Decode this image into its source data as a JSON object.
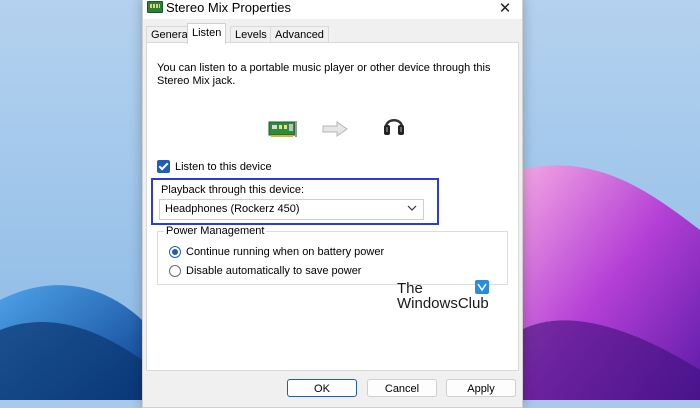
{
  "window": {
    "title": "Stereo Mix Properties",
    "app_icon": "sound-card-icon",
    "close_glyph": "✕"
  },
  "tabs": [
    {
      "label": "General",
      "active": false
    },
    {
      "label": "Listen",
      "active": true
    },
    {
      "label": "Levels",
      "active": false
    },
    {
      "label": "Advanced",
      "active": false
    }
  ],
  "listen": {
    "description": "You can listen to a portable music player or other device through this Stereo Mix jack.",
    "graphic_icons": [
      "sound-card-icon",
      "arrow-right-icon",
      "headphones-icon"
    ],
    "listen_checkbox": {
      "label": "Listen to this device",
      "checked": true
    },
    "playback": {
      "label": "Playback through this device:",
      "selected": "Headphones (Rockerz 450)"
    },
    "power": {
      "legend": "Power Management",
      "options": [
        {
          "label": "Continue running when on battery power",
          "selected": true
        },
        {
          "label": "Disable automatically to save power",
          "selected": false
        }
      ]
    }
  },
  "buttons": {
    "ok": "OK",
    "cancel": "Cancel",
    "apply": "Apply"
  },
  "watermark": {
    "line1": "The",
    "line2": "WindowsClub"
  },
  "colors": {
    "accent": "#1d5fb8",
    "highlight_box": "#2e3bd6",
    "wallpaper_left": "#1f6fbf",
    "wallpaper_right": "#8a2be2"
  }
}
